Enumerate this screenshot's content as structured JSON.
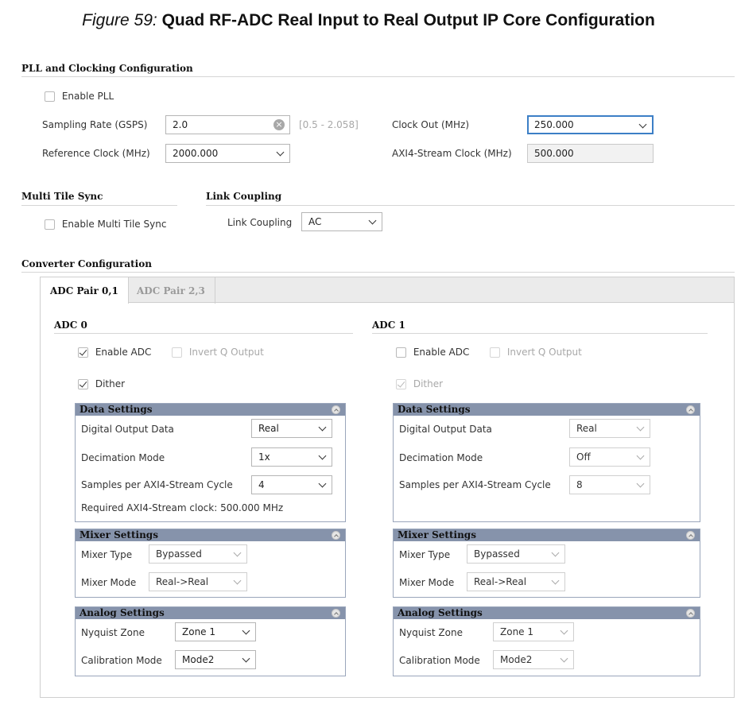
{
  "figure": {
    "prefix": "Figure 59:",
    "title": "Quad RF-ADC Real Input to Real Output IP Core Configuration"
  },
  "pll": {
    "section_title": "PLL and Clocking Configuration",
    "enable_pll_label": "Enable PLL",
    "enable_pll_checked": false,
    "sampling_rate_label": "Sampling Rate (GSPS)",
    "sampling_rate_value": "2.0",
    "sampling_rate_range": "[0.5 - 2.058]",
    "reference_clock_label": "Reference Clock (MHz)",
    "reference_clock_value": "2000.000",
    "clock_out_label": "Clock Out (MHz)",
    "clock_out_value": "250.000",
    "axi_clock_label": "AXI4-Stream Clock (MHz)",
    "axi_clock_value": "500.000"
  },
  "mts": {
    "section_title": "Multi Tile Sync",
    "enable_label": "Enable Multi Tile Sync",
    "enable_checked": false
  },
  "link": {
    "section_title": "Link Coupling",
    "label": "Link Coupling",
    "value": "AC"
  },
  "converter": {
    "section_title": "Converter Configuration",
    "tabs": [
      {
        "label": "ADC Pair 0,1",
        "active": true
      },
      {
        "label": "ADC Pair 2,3",
        "active": false
      }
    ],
    "adcs": [
      {
        "title": "ADC 0",
        "enable_label": "Enable ADC",
        "enable_checked": true,
        "invert_label": "Invert Q Output",
        "invert_checked": false,
        "dither_label": "Dither",
        "dither_checked": true,
        "data_settings": {
          "title": "Data Settings",
          "digital_output_label": "Digital Output Data",
          "digital_output_value": "Real",
          "decimation_label": "Decimation Mode",
          "decimation_value": "1x",
          "samples_label": "Samples per AXI4-Stream Cycle",
          "samples_value": "4",
          "required_clock": "Required AXI4-Stream clock: 500.000 MHz"
        },
        "mixer_settings": {
          "title": "Mixer Settings",
          "type_label": "Mixer Type",
          "type_value": "Bypassed",
          "mode_label": "Mixer Mode",
          "mode_value": "Real->Real"
        },
        "analog_settings": {
          "title": "Analog Settings",
          "nyquist_label": "Nyquist Zone",
          "nyquist_value": "Zone 1",
          "calibration_label": "Calibration Mode",
          "calibration_value": "Mode2"
        }
      },
      {
        "title": "ADC 1",
        "enable_label": "Enable ADC",
        "enable_checked": false,
        "invert_label": "Invert Q Output",
        "invert_checked": false,
        "dither_label": "Dither",
        "dither_checked": true,
        "data_settings": {
          "title": "Data Settings",
          "digital_output_label": "Digital Output Data",
          "digital_output_value": "Real",
          "decimation_label": "Decimation Mode",
          "decimation_value": "Off",
          "samples_label": "Samples per AXI4-Stream Cycle",
          "samples_value": "8"
        },
        "mixer_settings": {
          "title": "Mixer Settings",
          "type_label": "Mixer Type",
          "type_value": "Bypassed",
          "mode_label": "Mixer Mode",
          "mode_value": "Real->Real"
        },
        "analog_settings": {
          "title": "Analog Settings",
          "nyquist_label": "Nyquist Zone",
          "nyquist_value": "Zone 1",
          "calibration_label": "Calibration Mode",
          "calibration_value": "Mode2"
        }
      }
    ]
  },
  "colors": {
    "group_header": "#8693ab",
    "focus_border": "#3c7fc6",
    "tab_bar": "#ebebeb"
  }
}
